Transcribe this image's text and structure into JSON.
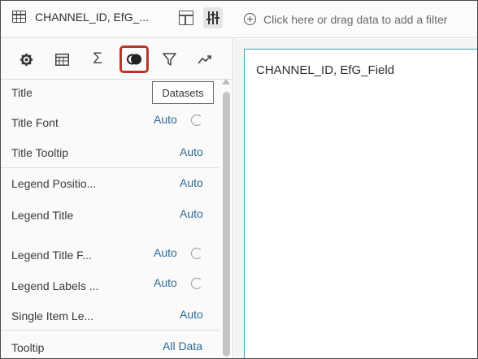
{
  "header": {
    "vis_title": "CHANNEL_ID, EfG_..."
  },
  "tabs": [
    {
      "name": "properties",
      "icon": "gear-icon"
    },
    {
      "name": "table",
      "icon": "table-icon"
    },
    {
      "name": "values",
      "icon": "sigma-icon"
    },
    {
      "name": "datasets",
      "icon": "datasets-icon",
      "active": true
    },
    {
      "name": "filters",
      "icon": "filter-icon"
    },
    {
      "name": "analytics",
      "icon": "trend-icon"
    }
  ],
  "tooltip": "Datasets",
  "properties": [
    {
      "label": "Title",
      "value": ""
    },
    {
      "label": "Title Font",
      "value": "Auto",
      "reset": true
    },
    {
      "label": "Title Tooltip",
      "value": "Auto"
    },
    {
      "label": "Legend Positio...",
      "value": "Auto"
    },
    {
      "label": "Legend Title",
      "value": "Auto"
    },
    {
      "label": "Legend Title F...",
      "value": "Auto",
      "reset": true
    },
    {
      "label": "Legend Labels ...",
      "value": "Auto",
      "reset": true
    },
    {
      "label": "Single Item Le...",
      "value": "Auto"
    },
    {
      "label": "Tooltip",
      "value": "All Data"
    }
  ],
  "filterbar": {
    "placeholder": "Click here or drag data to add a filter"
  },
  "canvas": {
    "viz_title": "CHANNEL_ID, EfG_Field"
  },
  "colors": {
    "accent": "#b8372a",
    "value_text": "#2e6a96",
    "viz_border": "#3aa0a8"
  }
}
